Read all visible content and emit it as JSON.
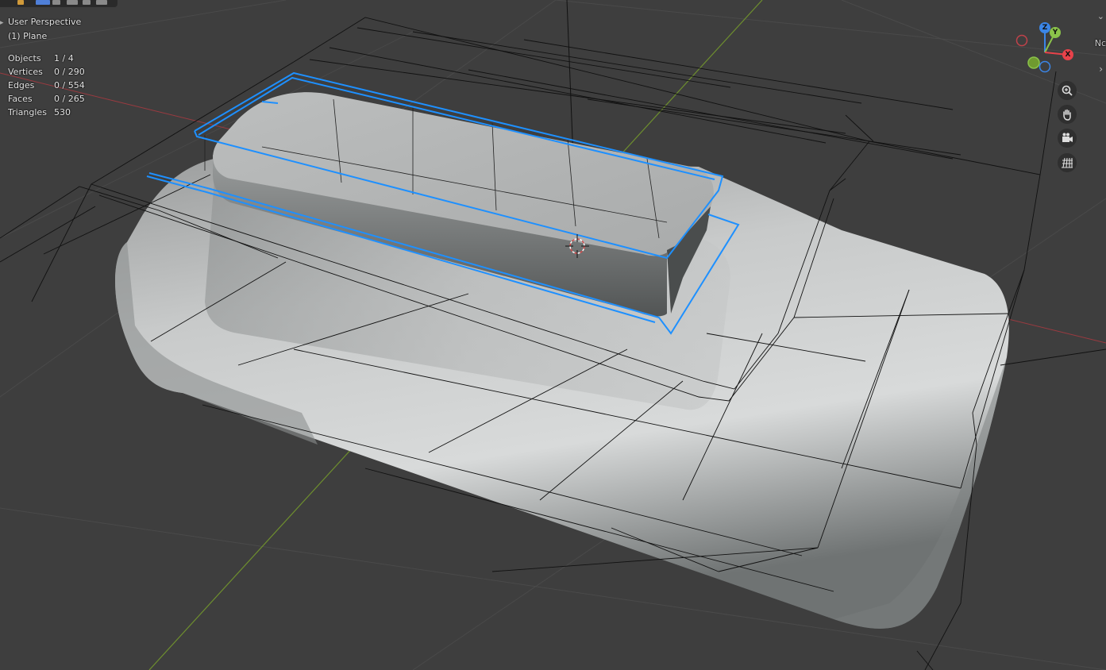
{
  "view": {
    "perspective": "User Perspective",
    "object": "(1) Plane"
  },
  "stats": [
    {
      "label": "Objects",
      "value": "1 / 4"
    },
    {
      "label": "Vertices",
      "value": "0 / 290"
    },
    {
      "label": "Edges",
      "value": "0 / 554"
    },
    {
      "label": "Faces",
      "value": "0 / 265"
    },
    {
      "label": "Triangles",
      "value": "530"
    }
  ],
  "gizmo": {
    "z": "Z",
    "y": "Y",
    "x": "X"
  },
  "edge_hint": "Nc",
  "colors": {
    "selection": "#1e90ff",
    "x_axis": "#e8424a",
    "y_axis": "#8bc34a",
    "z_axis": "#3b86e8",
    "background": "#3e3e3e"
  },
  "icons": [
    "zoom-icon",
    "hand-pan-icon",
    "camera-icon",
    "grid-icon"
  ]
}
